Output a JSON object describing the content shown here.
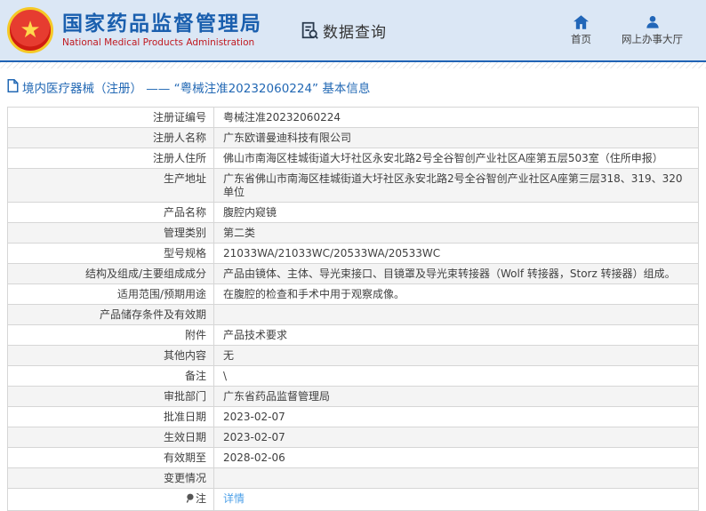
{
  "header": {
    "org_name_cn": "国家药品监督管理局",
    "org_name_en": "National Medical Products Administration",
    "data_query_label": "数据查询",
    "nav": [
      {
        "icon": "home-icon",
        "label": "首页"
      },
      {
        "icon": "user-icon",
        "label": "网上办事大厅"
      }
    ]
  },
  "breadcrumb": {
    "text": "境内医疗器械（注册） —— “粤械注准20232060224” 基本信息"
  },
  "table": {
    "rows": [
      {
        "label": "注册证编号",
        "value": "粤械注准20232060224"
      },
      {
        "label": "注册人名称",
        "value": "广东欧谱曼迪科技有限公司"
      },
      {
        "label": "注册人住所",
        "value": "佛山市南海区桂城街道大圩社区永安北路2号全谷智创产业社区A座第五层503室（住所申报）"
      },
      {
        "label": "生产地址",
        "value": "广东省佛山市南海区桂城街道大圩社区永安北路2号全谷智创产业社区A座第三层318、319、320单位"
      },
      {
        "label": "产品名称",
        "value": "腹腔内窥镜"
      },
      {
        "label": "管理类别",
        "value": "第二类"
      },
      {
        "label": "型号规格",
        "value": "21033WA/21033WC/20533WA/20533WC"
      },
      {
        "label": "结构及组成/主要组成成分",
        "value": "产品由镜体、主体、导光束接口、目镜罩及导光束转接器（Wolf 转接器，Storz 转接器）组成。"
      },
      {
        "label": "适用范围/预期用途",
        "value": "在腹腔的检查和手术中用于观察成像。"
      },
      {
        "label": "产品储存条件及有效期",
        "value": ""
      },
      {
        "label": "附件",
        "value": "产品技术要求"
      },
      {
        "label": "其他内容",
        "value": "无"
      },
      {
        "label": "备注",
        "value": "\\"
      },
      {
        "label": "审批部门",
        "value": "广东省药品监督管理局"
      },
      {
        "label": "批准日期",
        "value": "2023-02-07"
      },
      {
        "label": "生效日期",
        "value": "2023-02-07"
      },
      {
        "label": "有效期至",
        "value": "2028-02-06"
      },
      {
        "label": "变更情况",
        "value": ""
      },
      {
        "label": "注",
        "value": "详情",
        "is_link": true,
        "has_icon": true
      }
    ]
  },
  "icons": {
    "emblem": "national-emblem",
    "data_query": "doc-search-icon",
    "breadcrumb": "file-icon",
    "note_row": "note-icon"
  },
  "colors": {
    "header_bg": "#dbe7f5",
    "title_blue": "#1a5fae",
    "subtitle_red": "#c01920",
    "divider_blue": "#2063b4",
    "breadcrumb_blue": "#2268b4",
    "nav_icon_blue": "#2166b8",
    "table_border": "#d6d6d6",
    "alt_row_bg": "#f4f4f4",
    "link_blue": "#4da0e8"
  }
}
